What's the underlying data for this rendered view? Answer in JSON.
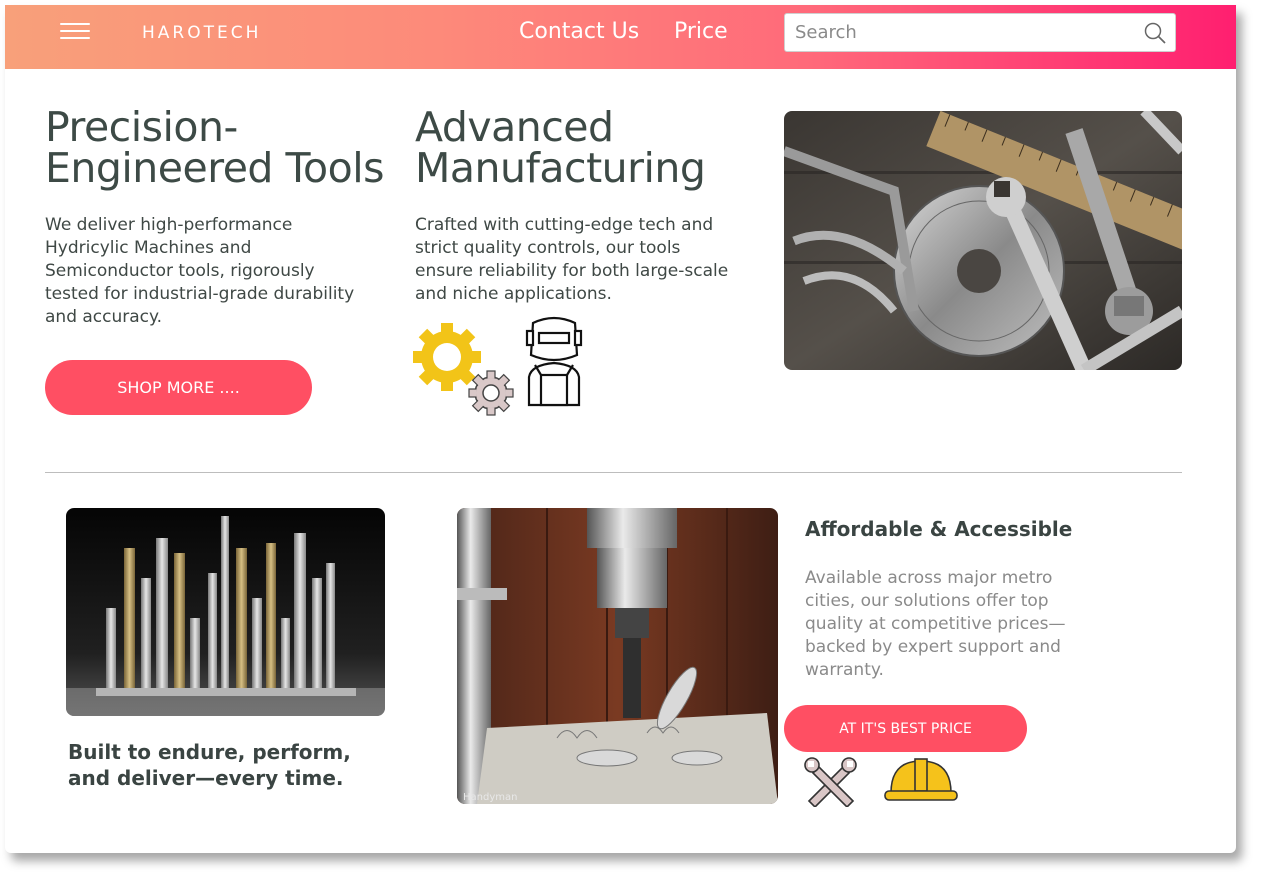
{
  "header": {
    "brand": "HAROTECH",
    "nav": [
      {
        "label": "Contact Us"
      },
      {
        "label": "Price"
      }
    ],
    "search": {
      "placeholder": "Search",
      "value": ""
    },
    "gradient_colors": [
      "#f8a07a",
      "#ff1f70"
    ]
  },
  "hero": {
    "left": {
      "title_line1": "Precision-",
      "title_line2": "Engineered Tools",
      "body_line1": "We deliver high-performance",
      "body_line2": "Hydricylic Machines and",
      "body_line3": "Semiconductor tools, rigorously",
      "body_line4": "tested for industrial-grade durability",
      "body_line5": "and accuracy.",
      "button_label": "SHOP MORE ...."
    },
    "middle": {
      "title_line1": "Advanced",
      "title_line2": "Manufacturing",
      "body_line1": "Crafted with cutting-edge tech and",
      "body_line2": "strict quality controls, our tools",
      "body_line3": "ensure reliability for both large-scale",
      "body_line4": "and niche applications.",
      "icons": [
        "gears-icon",
        "welder-icon"
      ]
    },
    "right_image": "tools-collection-photo"
  },
  "lower": {
    "screws_image": "screws-photo",
    "tagline_line1": "Built to endure, perform,",
    "tagline_line2": "and deliver—every time.",
    "drill_image": "drill-press-photo",
    "drill_watermark": "Handyman",
    "affordable": {
      "title": "Affordable & Accessible",
      "body_line1": "Available across major metro",
      "body_line2": "cities, our solutions offer top",
      "body_line3": "quality at competitive prices—",
      "body_line4": "backed by expert support and",
      "body_line5": "warranty.",
      "button_label": "AT IT'S BEST PRICE",
      "icons": [
        "wrench-screwdriver-icon",
        "hard-hat-icon"
      ]
    }
  },
  "colors": {
    "accent_button": "#ff4f63",
    "heading": "#3d4a46",
    "muted_text": "#8a8a8a"
  }
}
